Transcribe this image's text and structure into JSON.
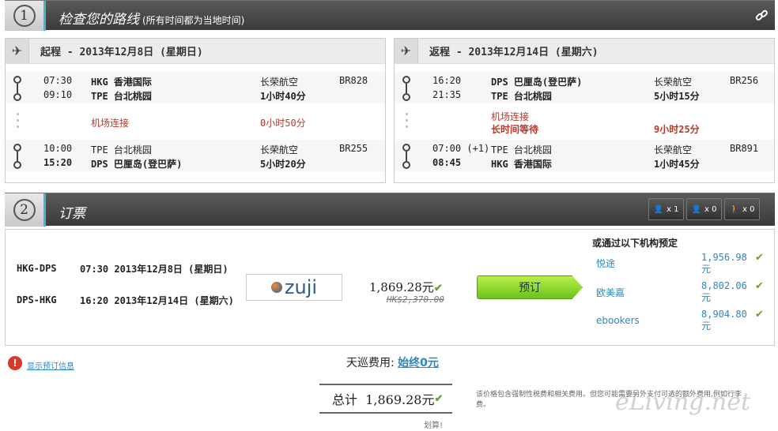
{
  "step1": {
    "num": "1",
    "title": "检查您的路线",
    "note": "(所有时间都为当地时间)"
  },
  "outbound": {
    "header": "起程 - 2013年12月8日 (星期日)",
    "seg1": {
      "dep_time": "07:30",
      "dep_airport": "HKG 香港国际",
      "arr_time": "09:10",
      "arr_airport": "TPE 台北桃园",
      "airline": "长荣航空",
      "duration": "1小时40分",
      "flight": "BR828"
    },
    "connection": {
      "label": "机场连接",
      "time": "0小时50分"
    },
    "seg2": {
      "dep_time": "10:00",
      "dep_airport": "TPE 台北桃园",
      "arr_time": "15:20",
      "arr_airport": "DPS 巴厘岛(登巴萨)",
      "airline": "长荣航空",
      "duration": "5小时20分",
      "flight": "BR255"
    }
  },
  "return": {
    "header": "返程 - 2013年12月14日 (星期六)",
    "seg1": {
      "dep_time": "16:20",
      "dep_airport": "DPS 巴厘岛(登巴萨)",
      "arr_time": "21:35",
      "arr_airport": "TPE 台北桃园",
      "airline": "长荣航空",
      "duration": "5小时15分",
      "flight": "BR256"
    },
    "connection": {
      "label": "机场连接",
      "label2": "长时间等待",
      "time": "9小时25分"
    },
    "seg2": {
      "dep_time": "07:00 (+1)",
      "dep_airport": "TPE 台北桃园",
      "arr_time": "08:45",
      "arr_airport": "HKG 香港国际",
      "airline": "长荣航空",
      "duration": "1小时45分",
      "flight": "BR891"
    }
  },
  "step2": {
    "num": "2",
    "title": "订票",
    "adult": "x 1",
    "child": "x 0",
    "infant": "x 0"
  },
  "booking": {
    "route1": "HKG-DPS",
    "time1": "07:30 2013年12月8日 (星期日)",
    "route2": "DPS-HKG",
    "time2": "16:20 2013年12月14日 (星期六)",
    "provider": "zuji",
    "price": "1,869.28元",
    "price_hkd": "HK$2,370.00",
    "book_label": "预订",
    "alt_title": "或通过以下机构预定"
  },
  "agencies": [
    {
      "name": "悦途",
      "price": "1,956.98元"
    },
    {
      "name": "欧美嘉",
      "price": "8,802.06元"
    },
    {
      "name": "ebookers",
      "price": "8,904.80元"
    }
  ],
  "footer": {
    "info_link": "显示预订信息",
    "fee_label": "天巡费用:",
    "fee_value": "始终0元",
    "total_label": "总计",
    "total_value": "1,869.28元",
    "disclaimer": "该价格包含强制性税费和相关费用。但您可能需要另外支付可选的额外费用,例如行李费。",
    "cheap": "划算!",
    "watermark": "eLiving.net"
  }
}
